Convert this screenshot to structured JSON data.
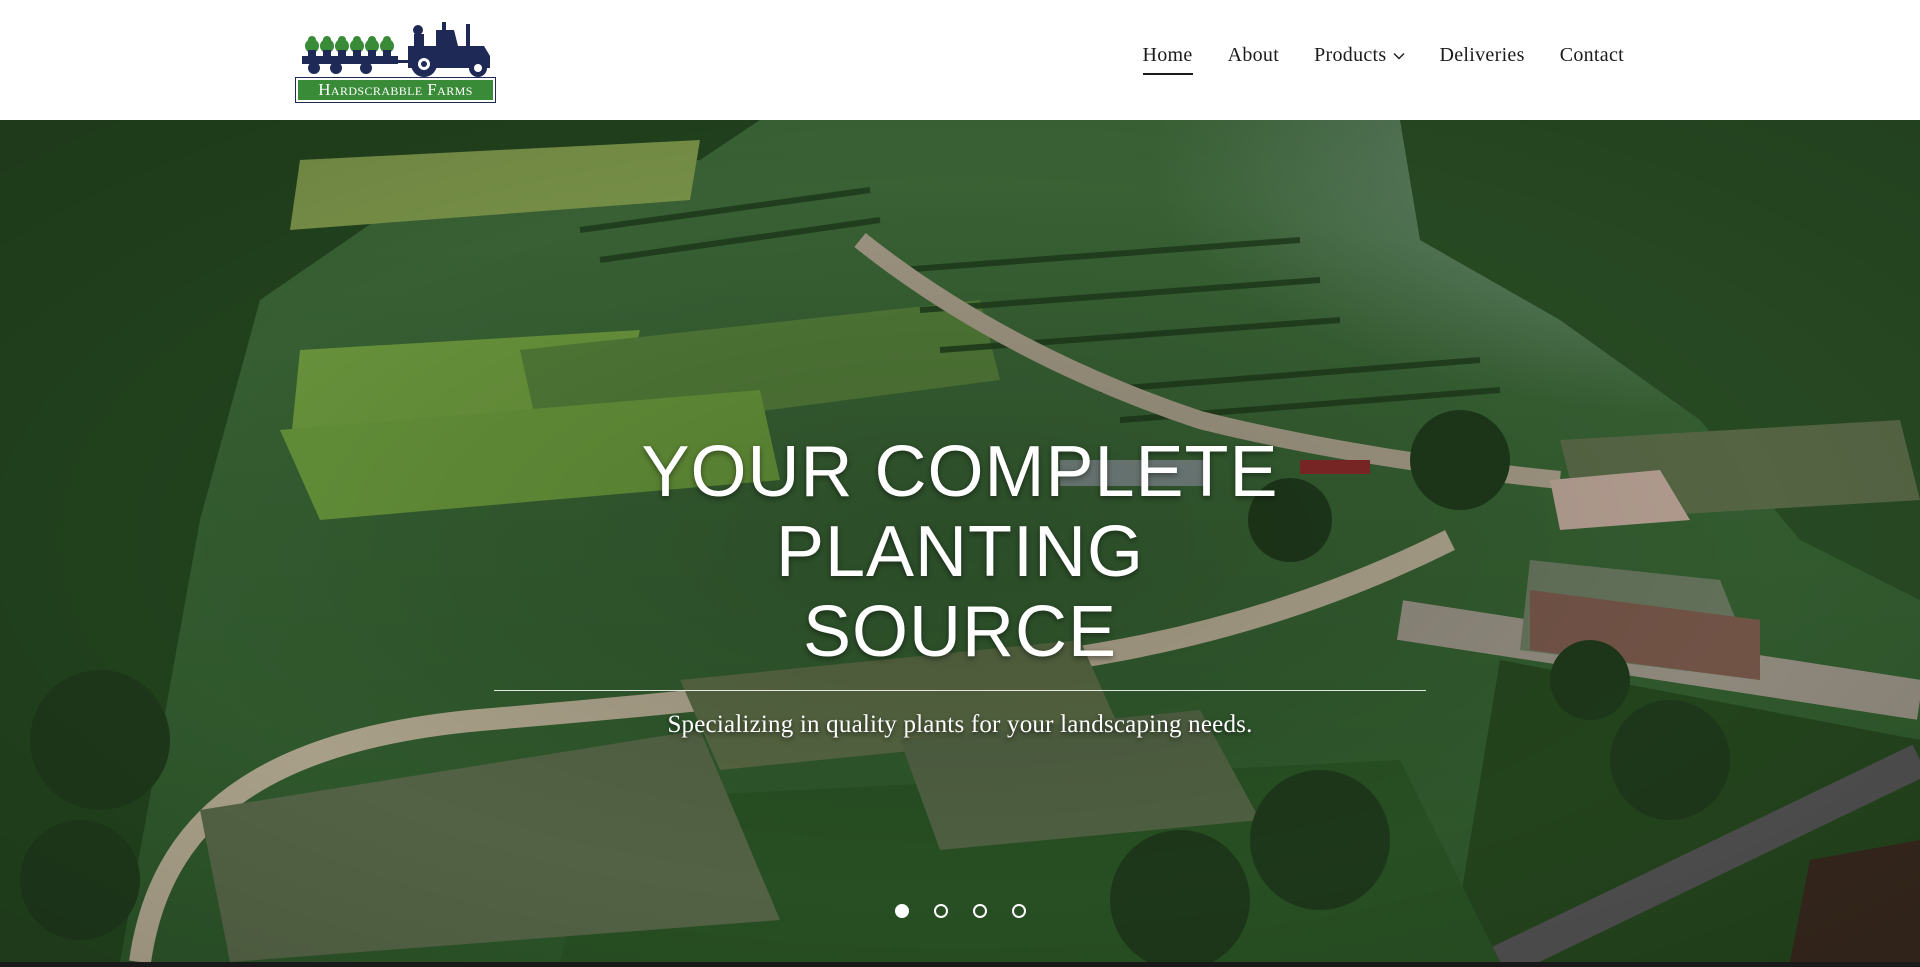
{
  "brand": {
    "name": "Hardscrabble Farms",
    "colors": {
      "navy": "#1e2a55",
      "green": "#3a8b37"
    }
  },
  "nav": {
    "items": [
      {
        "label": "Home",
        "active": true
      },
      {
        "label": "About"
      },
      {
        "label": "Products",
        "has_dropdown": true,
        "icon": "chevron-down-icon"
      },
      {
        "label": "Deliveries"
      },
      {
        "label": "Contact"
      }
    ]
  },
  "hero": {
    "title_line1": "YOUR COMPLETE",
    "title_line2": "PLANTING SOURCE",
    "subtitle": "Specializing in quality plants for your landscaping needs.",
    "slides_total": 4,
    "slide_active": 1
  }
}
